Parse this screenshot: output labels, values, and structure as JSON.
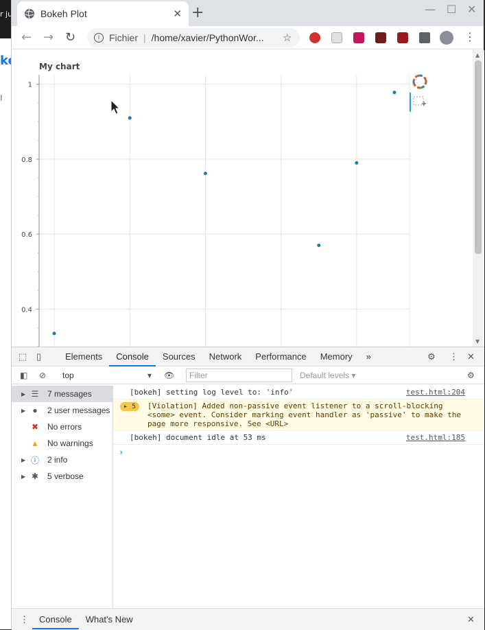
{
  "background_page": {
    "cut_text_top": "r ju",
    "cut_text_blue": "ke",
    "cut_text_gray": "I"
  },
  "browser": {
    "tab_title": "Bokeh Plot",
    "new_tab": "+",
    "address_scheme": "Fichier",
    "address_path": "/home/xavier/PythonWor..."
  },
  "chart_data": {
    "type": "scatter",
    "title": "My chart",
    "xlabel": "",
    "ylabel": "",
    "y_ticks": [
      "1",
      "0.8",
      "0.6",
      "0.4"
    ],
    "ylim_visible": [
      0.3,
      1.025
    ],
    "x_range": [
      -0.2,
      4.7
    ],
    "grid": true,
    "x": [
      0,
      1,
      2,
      3.5,
      4,
      4.5
    ],
    "y": [
      0.335,
      0.91,
      0.762,
      0.57,
      0.79,
      0.978
    ],
    "color": "#1f77b4"
  },
  "devtools": {
    "tabs": [
      "Elements",
      "Console",
      "Sources",
      "Network",
      "Performance",
      "Memory"
    ],
    "more": "»",
    "context": "top",
    "filter_placeholder": "Filter",
    "levels": "Default levels ▾",
    "sidebar": [
      {
        "label": "7 messages",
        "icon": "list-icon"
      },
      {
        "label": "2 user messages",
        "icon": "user-icon"
      },
      {
        "label": "No errors",
        "icon": "error-icon"
      },
      {
        "label": "No warnings",
        "icon": "warning-icon"
      },
      {
        "label": "2 info",
        "icon": "info-icon"
      },
      {
        "label": "5 verbose",
        "icon": "bug-icon"
      }
    ],
    "messages": [
      {
        "text": "[bokeh] setting log level to: 'info'",
        "source": "test.html:204"
      },
      {
        "badge": "▸ 5",
        "text": "[Violation] Added non-passive event listener to a scroll-blocking <some> event. Consider marking event handler as 'passive' to make the page more responsive. See <URL>"
      },
      {
        "text": "[bokeh] document idle at 53 ms",
        "source": "test.html:185"
      }
    ],
    "prompt": "›",
    "drawer_tabs": [
      "Console",
      "What's New"
    ]
  }
}
